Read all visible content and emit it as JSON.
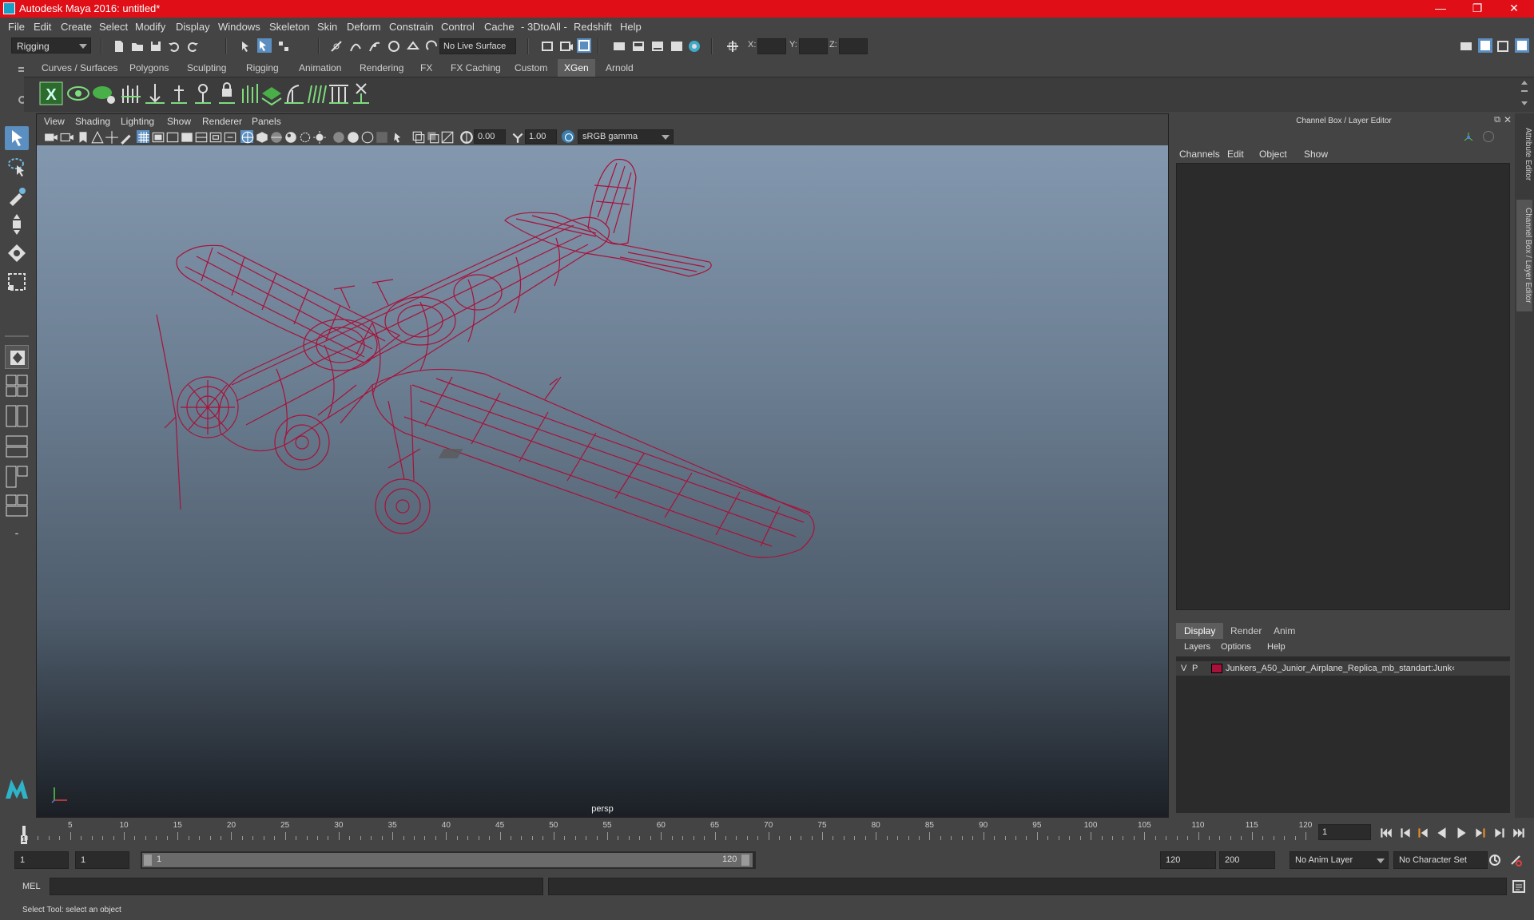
{
  "window": {
    "title": "Autodesk Maya 2016: untitled*",
    "minimize": "—",
    "restore": "❐",
    "close": "✕"
  },
  "menubar": [
    "File",
    "Edit",
    "Create",
    "Select",
    "Modify",
    "Display",
    "Windows",
    "Skeleton",
    "Skin",
    "Deform",
    "Constrain",
    "Control",
    "Cache",
    "- 3DtoAll -",
    "Redshift",
    "Help"
  ],
  "statusline": {
    "mode": "Rigging",
    "live_surface": "No Live Surface",
    "x_label": "X:",
    "y_label": "Y:",
    "z_label": "Z:"
  },
  "shelf": {
    "tabs": [
      "Curves / Surfaces",
      "Polygons",
      "Sculpting",
      "Rigging",
      "Animation",
      "Rendering",
      "FX",
      "FX Caching",
      "Custom",
      "XGen",
      "Arnold"
    ],
    "active_tab": "XGen"
  },
  "viewport": {
    "menu": [
      "View",
      "Shading",
      "Lighting",
      "Show",
      "Renderer",
      "Panels"
    ],
    "exposure": "0.00",
    "gamma": "1.00",
    "color_space": "sRGB gamma",
    "camera_label": "persp",
    "wire_color": "#a8123a"
  },
  "channelbox": {
    "title": "Channel Box / Layer Editor",
    "menu": [
      "Channels",
      "Edit",
      "Object",
      "Show"
    ],
    "layer_tabs": [
      "Display",
      "Render",
      "Anim"
    ],
    "layer_menu": [
      "Layers",
      "Options",
      "Help"
    ],
    "layer": {
      "v": "V",
      "p": "P",
      "name": "Junkers_A50_Junior_Airplane_Replica_mb_standart:Junk‹"
    }
  },
  "sidetabs": [
    "Attribute Editor",
    "Channel Box / Layer Editor"
  ],
  "timeslider": {
    "ticks": [
      "5",
      "10",
      "15",
      "20",
      "25",
      "30",
      "35",
      "40",
      "45",
      "50",
      "55",
      "60",
      "65",
      "70",
      "75",
      "80",
      "85",
      "90",
      "95",
      "100",
      "105",
      "110",
      "115",
      "120"
    ],
    "current_marker": "1",
    "current_frame": "1"
  },
  "rangeslider": {
    "start": "1",
    "playback_start": "1",
    "range_start": "1",
    "range_end": "120",
    "playback_end": "120",
    "end": "200",
    "anim_layer": "No Anim Layer",
    "character_set": "No Character Set"
  },
  "cmdline": {
    "label": "MEL"
  },
  "helpline": {
    "text": "Select Tool: select an object"
  }
}
